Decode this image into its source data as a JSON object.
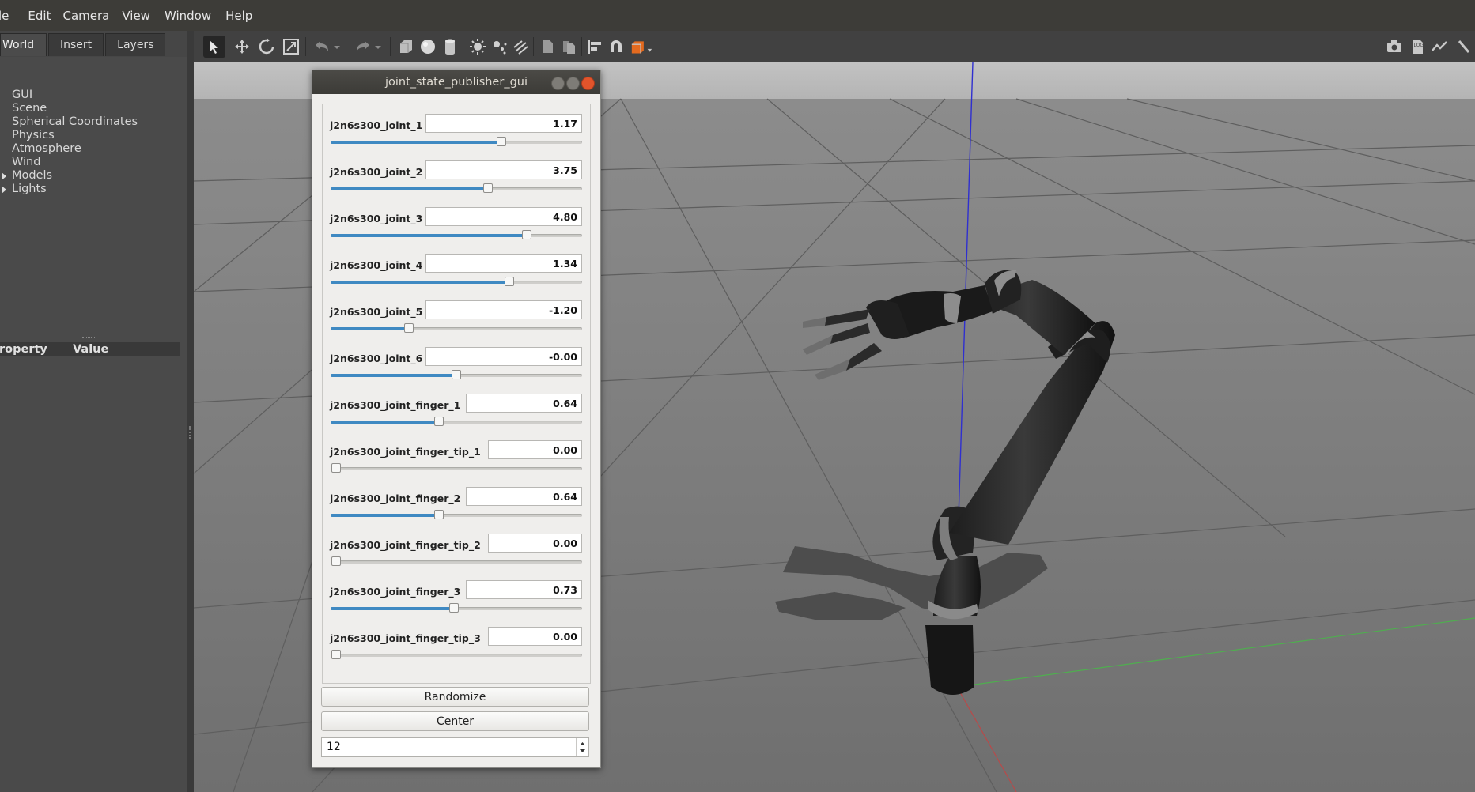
{
  "menubar": {
    "items": [
      "le",
      "Edit",
      "Camera",
      "View",
      "Window",
      "Help"
    ]
  },
  "left_panel": {
    "tabs": [
      "World",
      "Insert",
      "Layers"
    ],
    "tree": [
      {
        "label": "GUI",
        "expandable": false
      },
      {
        "label": "Scene",
        "expandable": false
      },
      {
        "label": "Spherical Coordinates",
        "expandable": false
      },
      {
        "label": "Physics",
        "expandable": false
      },
      {
        "label": "Atmosphere",
        "expandable": false
      },
      {
        "label": "Wind",
        "expandable": false
      },
      {
        "label": "Models",
        "expandable": true
      },
      {
        "label": "Lights",
        "expandable": true
      }
    ],
    "property_header": {
      "property": "roperty",
      "value": "Value"
    }
  },
  "toolbar": {
    "icons": [
      "select-arrow-icon",
      "translate-icon",
      "rotate-icon",
      "scale-icon",
      "undo-icon",
      "undo-dropdown-icon",
      "redo-icon",
      "redo-dropdown-icon",
      "box-icon",
      "sphere-icon",
      "cylinder-icon",
      "point-light-icon",
      "spot-light-icon",
      "directional-light-icon",
      "copy-icon",
      "paste-icon",
      "align-icon",
      "snap-icon",
      "view-angle-icon",
      "screenshot-icon",
      "log-icon",
      "plot-icon",
      "record-icon"
    ]
  },
  "dialog": {
    "title": "joint_state_publisher_gui",
    "joints": [
      {
        "name": "j2n6s300_joint_1",
        "value": "1.17",
        "level": 0.68
      },
      {
        "name": "j2n6s300_joint_2",
        "value": "3.75",
        "level": 0.625
      },
      {
        "name": "j2n6s300_joint_3",
        "value": "4.80",
        "level": 0.78
      },
      {
        "name": "j2n6s300_joint_4",
        "value": "1.34",
        "level": 0.71
      },
      {
        "name": "j2n6s300_joint_5",
        "value": "-1.20",
        "level": 0.31
      },
      {
        "name": "j2n6s300_joint_6",
        "value": "-0.00",
        "level": 0.5
      },
      {
        "name": "j2n6s300_joint_finger_1",
        "value": "0.64",
        "level": 0.43
      },
      {
        "name": "j2n6s300_joint_finger_tip_1",
        "value": "0.00",
        "level": 0.0
      },
      {
        "name": "j2n6s300_joint_finger_2",
        "value": "0.64",
        "level": 0.43
      },
      {
        "name": "j2n6s300_joint_finger_tip_2",
        "value": "0.00",
        "level": 0.0
      },
      {
        "name": "j2n6s300_joint_finger_3",
        "value": "0.73",
        "level": 0.49
      },
      {
        "name": "j2n6s300_joint_finger_tip_3",
        "value": "0.00",
        "level": 0.0
      }
    ],
    "randomize_label": "Randomize",
    "center_label": "Center",
    "spinbox_value": "12"
  },
  "colors": {
    "slider_fill": "#3f89c2",
    "z_axis": "#2f2fd0",
    "x_axis": "#b84a4a",
    "y_axis": "#4fae4f",
    "close_button": "#e2542b"
  }
}
